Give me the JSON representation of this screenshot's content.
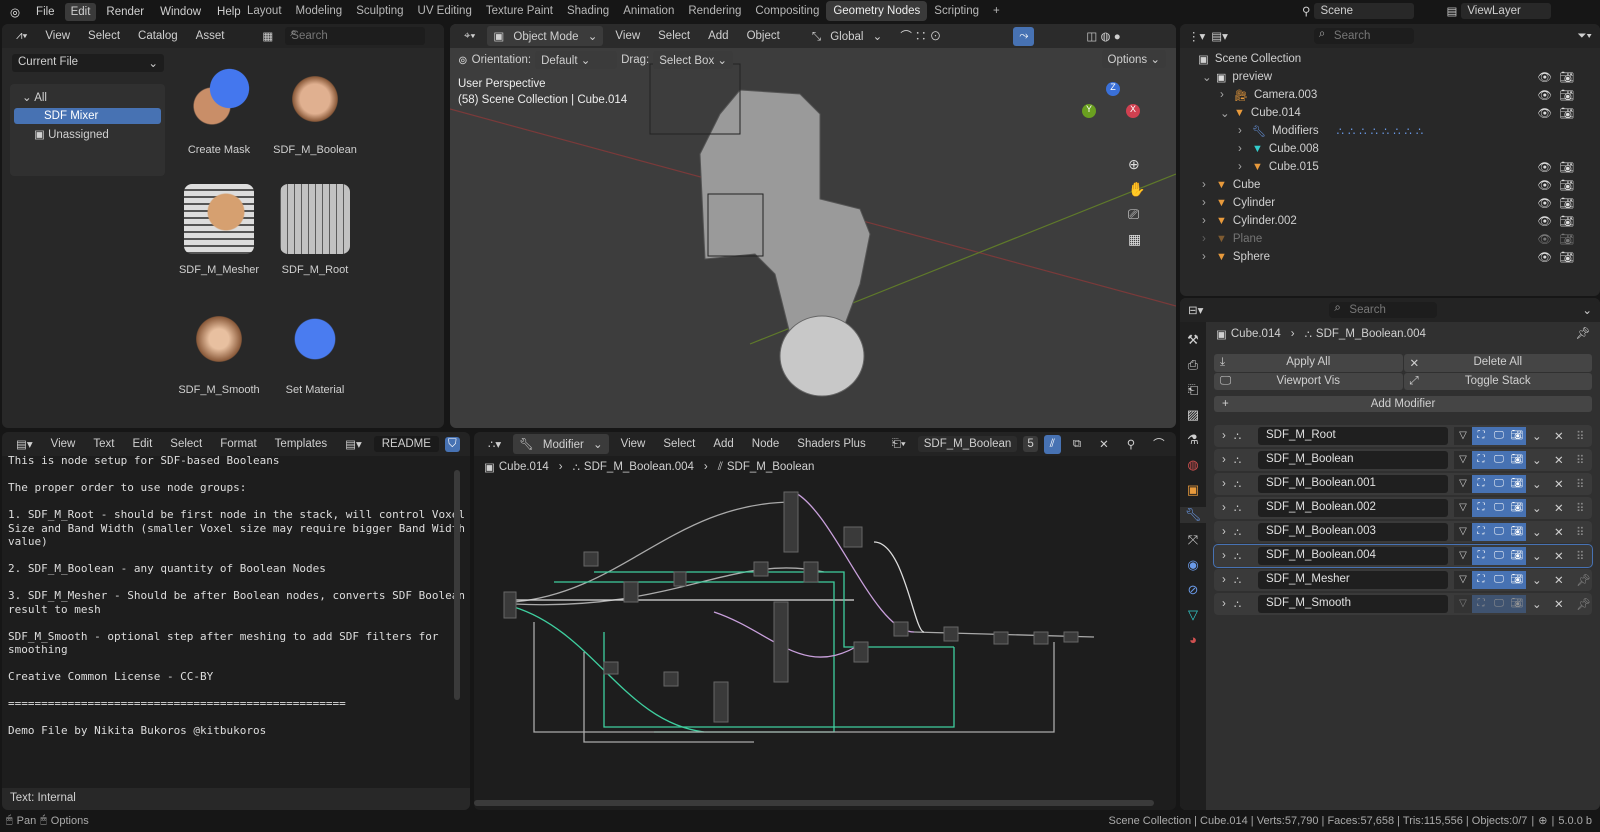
{
  "topbar": {
    "menus": [
      "File",
      "Edit",
      "Render",
      "Window",
      "Help"
    ],
    "workspaces": [
      "Layout",
      "Modeling",
      "Sculpting",
      "UV Editing",
      "Texture Paint",
      "Shading",
      "Animation",
      "Rendering",
      "Compositing",
      "Geometry Nodes",
      "Scripting"
    ],
    "active_workspace": "Geometry Nodes",
    "scene": "Scene",
    "view_layer": "ViewLayer"
  },
  "asset_browser": {
    "menus": [
      "View",
      "Select",
      "Catalog",
      "Asset"
    ],
    "search_placeholder": "Search",
    "library": "Current File",
    "tree": {
      "root": "All",
      "items": [
        "SDF Mixer",
        "Unassigned"
      ]
    },
    "assets": [
      "Create Mask",
      "SDF_M_Boolean",
      "SDF_M_Mesher",
      "SDF_M_Root",
      "SDF_M_Smooth",
      "Set Material"
    ]
  },
  "viewport": {
    "mode": "Object Mode",
    "menus": [
      "View",
      "Select",
      "Add",
      "Object"
    ],
    "transform": "Global",
    "orientation_label": "Orientation:",
    "orientation": "Default",
    "drag_label": "Drag:",
    "drag": "Select Box",
    "options": "Options",
    "overlay_title": "User Perspective",
    "overlay_sub": "(58) Scene Collection | Cube.014",
    "gizmo": {
      "x": "X",
      "y": "Y",
      "z": "Z"
    }
  },
  "outliner": {
    "search_placeholder": "Search",
    "root": "Scene Collection",
    "items": [
      {
        "name": "preview",
        "depth": 0,
        "open": true
      },
      {
        "name": "Camera.003",
        "depth": 1
      },
      {
        "name": "Cube.014",
        "depth": 1,
        "open": true
      },
      {
        "name": "Modifiers",
        "depth": 2
      },
      {
        "name": "Cube.008",
        "depth": 2
      },
      {
        "name": "Cube.015",
        "depth": 2
      },
      {
        "name": "Cube",
        "depth": 0
      },
      {
        "name": "Cylinder",
        "depth": 0
      },
      {
        "name": "Cylinder.002",
        "depth": 0
      },
      {
        "name": "Plane",
        "depth": 0,
        "disabled": true
      },
      {
        "name": "Sphere",
        "depth": 0
      }
    ]
  },
  "properties": {
    "search_placeholder": "Search",
    "breadcrumb": [
      "Cube.014",
      "SDF_M_Boolean.004"
    ],
    "apply_all": "Apply All",
    "delete_all": "Delete All",
    "viewport_vis": "Viewport Vis",
    "toggle_stack": "Toggle Stack",
    "add_modifier": "Add Modifier",
    "modifiers": [
      "SDF_M_Root",
      "SDF_M_Boolean",
      "SDF_M_Boolean.001",
      "SDF_M_Boolean.002",
      "SDF_M_Boolean.003",
      "SDF_M_Boolean.004",
      "SDF_M_Mesher",
      "SDF_M_Smooth"
    ],
    "active_modifier": "SDF_M_Boolean.004"
  },
  "text_editor": {
    "menus": [
      "View",
      "Text",
      "Edit",
      "Select",
      "Format",
      "Templates"
    ],
    "file": "README",
    "lines": [
      "This is node setup for SDF-based Booleans",
      "",
      "The proper order to use node groups:",
      "",
      "1. SDF_M_Root - should be first node in the stack, will control Voxel",
      "Size and Band Width (smaller Voxel size may require bigger Band Width",
      "value)",
      "",
      "2. SDF_M_Boolean - any quantity of Boolean Nodes",
      "",
      "3. SDF_M_Mesher - Should be after Boolean nodes, converts SDF Boolean",
      "result to mesh",
      "",
      "SDF_M_Smooth - optional step after meshing to add SDF filters for",
      "smoothing",
      "",
      "Creative Common License - CC-BY",
      "",
      "===================================================",
      "",
      "Demo File by Nikita Bukoros @kitbukoros"
    ],
    "footer": "Text: Internal"
  },
  "node_editor": {
    "context": "Modifier",
    "menus": [
      "View",
      "Select",
      "Add",
      "Node",
      "Shaders Plus"
    ],
    "node_group": "SDF_M_Boolean",
    "users": "5",
    "breadcrumb": [
      "Cube.014",
      "SDF_M_Boolean.004",
      "SDF_M_Boolean"
    ]
  },
  "statusbar": {
    "left": [
      "Pan",
      "Options"
    ],
    "stats": "Scene Collection | Cube.014 | Verts:57,790 | Faces:57,658 | Tris:115,556 | Objects:0/7",
    "version": "5.0.0 b"
  }
}
